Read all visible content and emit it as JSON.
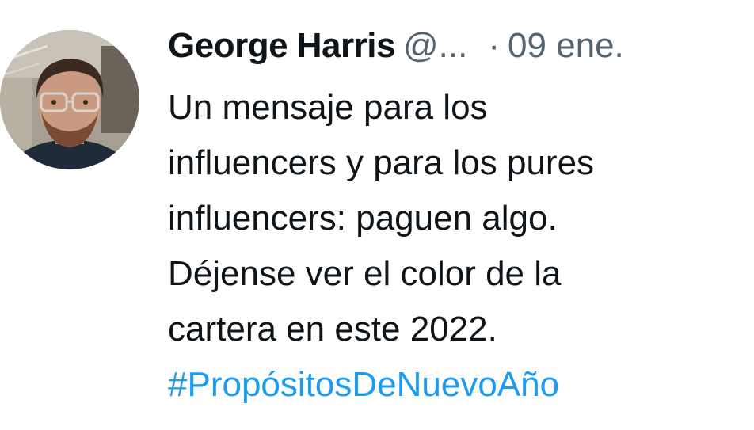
{
  "tweet": {
    "author_name": "George Harris",
    "author_handle": "@...",
    "separator": "·",
    "date": "09 ene.",
    "text_lines": [
      "Un mensaje para los",
      "influencers y para los pures",
      "influencers: paguen algo.",
      "Déjense ver el color de la",
      "cartera en este 2022."
    ],
    "hashtag": "#PropósitosDeNuevoAño"
  },
  "colors": {
    "text_primary": "#0f1419",
    "text_secondary": "#536471",
    "link": "#1d9bf0",
    "background": "#ffffff"
  },
  "icons": {
    "avatar": "profile-photo"
  }
}
